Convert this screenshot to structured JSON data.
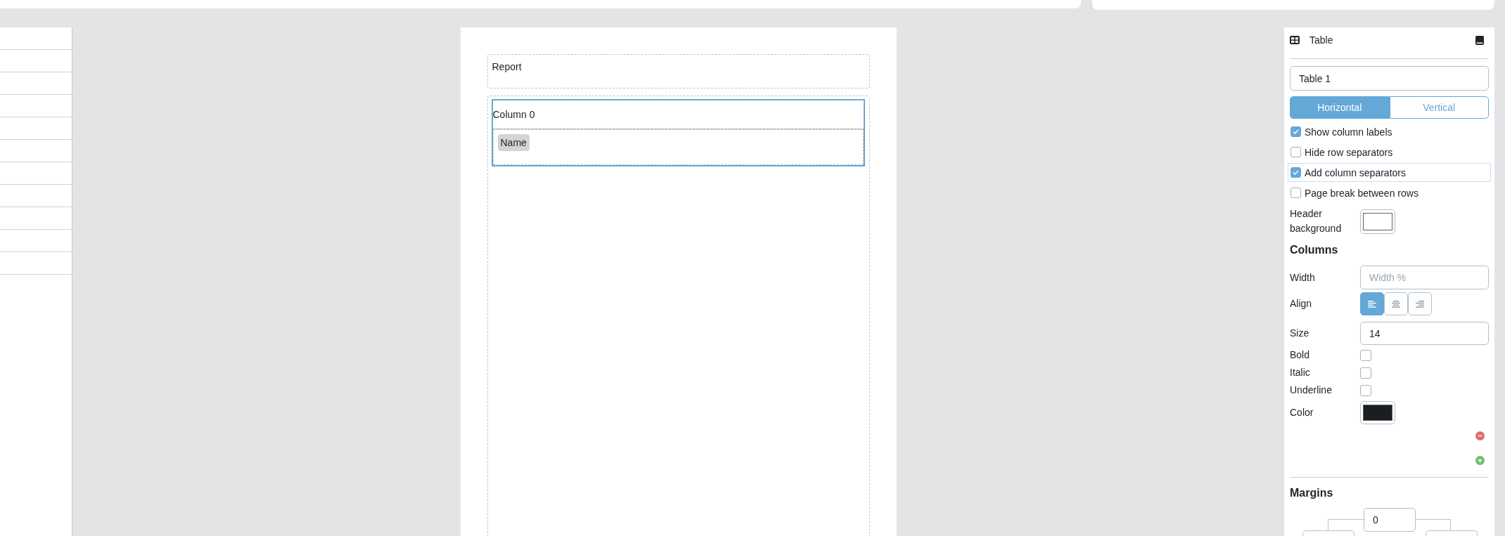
{
  "canvas": {
    "title_band": {
      "text": "Report"
    },
    "table": {
      "selected": true,
      "columns": [
        {
          "label": "Column 0",
          "fields": [
            {
              "label": "Name"
            }
          ]
        }
      ]
    }
  },
  "inspector": {
    "title": "Table",
    "name_field": {
      "value": "Table 1"
    },
    "orientation_tabs": [
      {
        "label": "Horizontal",
        "selected": true
      },
      {
        "label": "Vertical",
        "selected": false
      }
    ],
    "options": [
      {
        "label": "Show column labels",
        "checked": true,
        "focused": false
      },
      {
        "label": "Hide row separators",
        "checked": false,
        "focused": false
      },
      {
        "label": "Add column separators",
        "checked": true,
        "focused": true
      },
      {
        "label": "Page break between rows",
        "checked": false,
        "focused": false
      }
    ],
    "header_background": {
      "label": "Header background",
      "color": "#ffffff"
    },
    "columns": {
      "heading": "Columns",
      "width": {
        "label": "Width",
        "placeholder": "Width %"
      },
      "align": {
        "label": "Align",
        "options": [
          {
            "kind": "left",
            "selected": true
          },
          {
            "kind": "center",
            "selected": false
          },
          {
            "kind": "right",
            "selected": false
          }
        ]
      },
      "size": {
        "label": "Size",
        "value": "14"
      },
      "styles": [
        {
          "label": "Bold",
          "checked": false
        },
        {
          "label": "Italic",
          "checked": false
        },
        {
          "label": "Underline",
          "checked": false
        }
      ],
      "color": {
        "label": "Color",
        "color": "#1b1e21"
      }
    },
    "margins": {
      "heading": "Margins",
      "top": {
        "value": "0"
      }
    }
  }
}
